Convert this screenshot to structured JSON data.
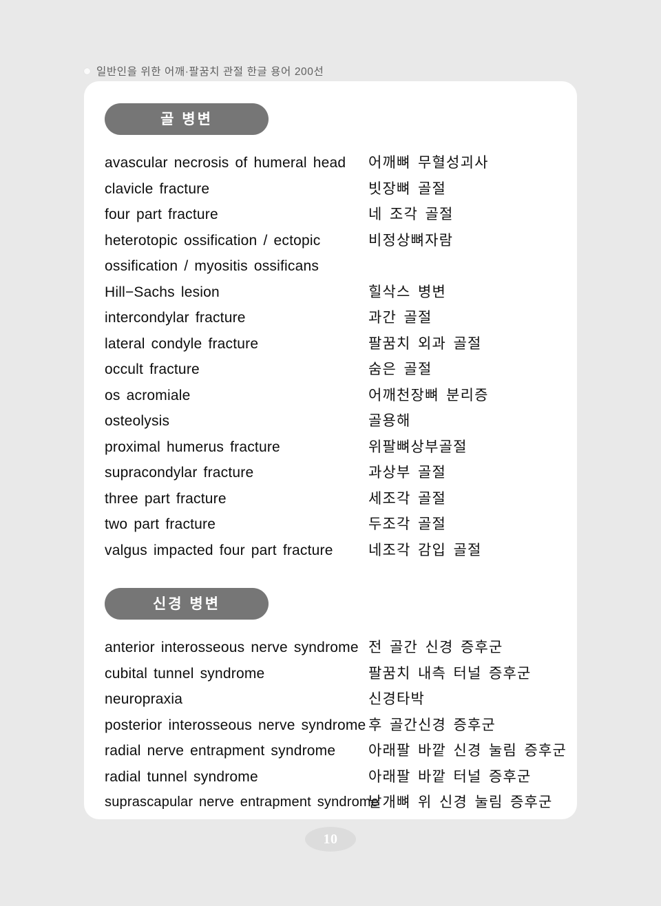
{
  "running_header": {
    "bullet_icon": "bullet-dot",
    "text": "일반인을 위한 어깨·팔꿈치 관절 한글 용어 200선"
  },
  "page_number": "10",
  "colors": {
    "page_background": "#e9e9e9",
    "panel_background": "#ffffff",
    "badge_background": "#767676",
    "badge_text": "#ffffff",
    "body_text": "#0d0d0d",
    "header_text": "#5f5f5f",
    "page_number_background": "#dcdcdc"
  },
  "sections": [
    {
      "badge": "골 병변",
      "entries": [
        {
          "en": "avascular necrosis of humeral head",
          "ko": "어깨뼈 무혈성괴사"
        },
        {
          "en": "clavicle fracture",
          "ko": "빗장뼈 골절"
        },
        {
          "en": "four part fracture",
          "ko": "네 조각 골절"
        },
        {
          "en": "heterotopic ossification / ectopic\nossification / myositis ossificans",
          "ko": "비정상뼈자람"
        },
        {
          "en": "Hill−Sachs lesion",
          "ko": "힐삭스 병변"
        },
        {
          "en": "intercondylar fracture",
          "ko": "과간 골절"
        },
        {
          "en": "lateral condyle fracture",
          "ko": "팔꿈치 외과 골절"
        },
        {
          "en": "occult fracture",
          "ko": "숨은 골절"
        },
        {
          "en": "os acromiale",
          "ko": "어깨천장뼈 분리증"
        },
        {
          "en": "osteolysis",
          "ko": "골용해"
        },
        {
          "en": "proximal humerus fracture",
          "ko": "위팔뼈상부골절"
        },
        {
          "en": "supracondylar fracture",
          "ko": "과상부 골절"
        },
        {
          "en": "three part fracture",
          "ko": "세조각 골절"
        },
        {
          "en": "two part fracture",
          "ko": "두조각 골절"
        },
        {
          "en": "valgus impacted four part fracture",
          "ko": "네조각 감입 골절"
        }
      ]
    },
    {
      "badge": "신경 병변",
      "entries": [
        {
          "en": "anterior interosseous nerve syndrome",
          "ko": "전 골간 신경 증후군"
        },
        {
          "en": "cubital tunnel syndrome",
          "ko": "팔꿈치 내측 터널 증후군"
        },
        {
          "en": "neuropraxia",
          "ko": "신경타박"
        },
        {
          "en": "posterior interosseous nerve syndrome",
          "ko": "후 골간신경 증후군"
        },
        {
          "en": "radial nerve entrapment syndrome",
          "ko": "아래팔 바깥 신경 눌림 증후군"
        },
        {
          "en": "radial tunnel syndrome",
          "ko": "아래팔 바깥 터널 증후군"
        },
        {
          "en": "suprascapular nerve entrapment syndrome",
          "ko": "날개뼈 위 신경 눌림 증후군"
        }
      ]
    }
  ]
}
